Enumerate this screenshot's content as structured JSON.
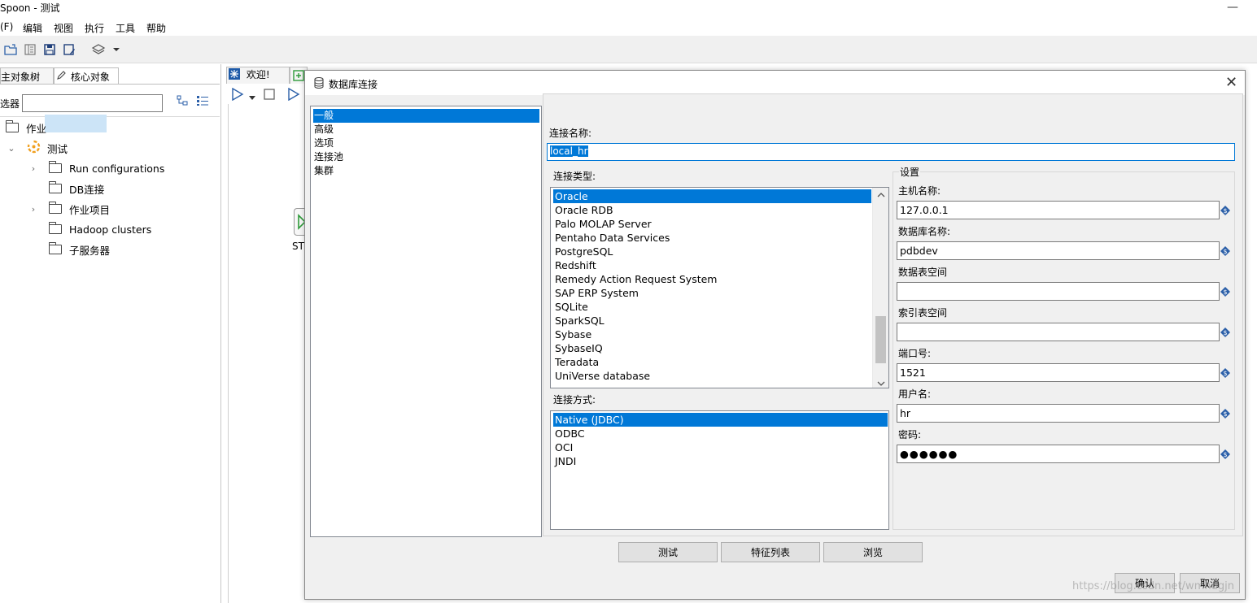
{
  "app": {
    "title": "Spoon - 测试"
  },
  "menu": [
    "(F)",
    "编辑",
    "视图",
    "执行",
    "工具",
    "帮助"
  ],
  "left_panel": {
    "tabs": [
      "主对象树",
      "核心对象"
    ],
    "filter_label": "选器",
    "tree": [
      {
        "label": "作业",
        "level": 0
      },
      {
        "label": "测试",
        "level": 1
      },
      {
        "label": "Run configurations",
        "level": 2
      },
      {
        "label": "DB连接",
        "level": 2
      },
      {
        "label": "作业项目",
        "level": 2
      },
      {
        "label": "Hadoop clusters",
        "level": 2
      },
      {
        "label": "子服务器",
        "level": 2
      }
    ]
  },
  "editor": {
    "tab_welcome": "欢迎!",
    "start_label": "ST"
  },
  "dialog": {
    "title": "数据库连接",
    "categories": [
      "一般",
      "高级",
      "选项",
      "连接池",
      "集群"
    ],
    "selected_category": "一般",
    "conn_name_label": "连接名称:",
    "conn_name_value": "local_hr",
    "conn_type_label": "连接类型:",
    "conn_types": [
      "Oracle",
      "Oracle RDB",
      "Palo MOLAP Server",
      "Pentaho Data Services",
      "PostgreSQL",
      "Redshift",
      "Remedy Action Request System",
      "SAP ERP System",
      "SQLite",
      "SparkSQL",
      "Sybase",
      "SybaseIQ",
      "Teradata",
      "UniVerse database"
    ],
    "selected_conn_type": "Oracle",
    "access_label": "连接方式:",
    "access_types": [
      "Native (JDBC)",
      "ODBC",
      "OCI",
      "JNDI"
    ],
    "selected_access": "Native (JDBC)",
    "settings": {
      "legend": "设置",
      "host_label": "主机名称:",
      "host_value": "127.0.0.1",
      "db_label": "数据库名称:",
      "db_value": "pdbdev",
      "tablespace_label": "数据表空间",
      "tablespace_value": "",
      "index_tablespace_label": "索引表空间",
      "index_tablespace_value": "",
      "port_label": "端口号:",
      "port_value": "1521",
      "user_label": "用户名:",
      "user_value": "hr",
      "password_label": "密码:",
      "password_value": "●●●●●●"
    },
    "buttons": {
      "test": "测试",
      "features": "特征列表",
      "explore": "浏览",
      "ok": "确认",
      "cancel": "取消"
    }
  },
  "watermark": "https://blog.csdn.net/wmhdgjn"
}
